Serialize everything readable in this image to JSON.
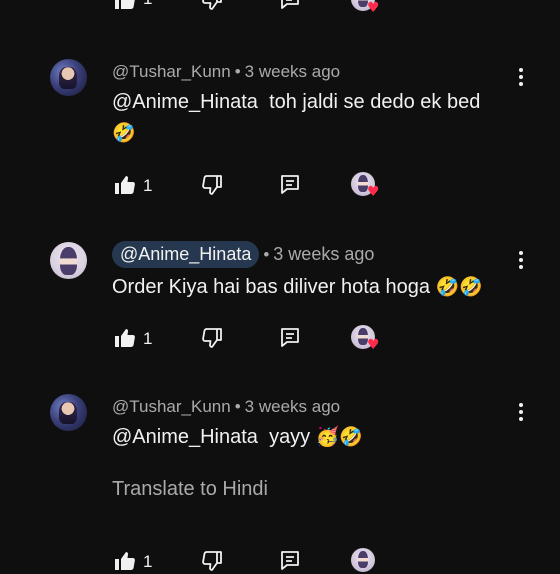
{
  "comments": [
    {
      "author": "@Tushar_Kunn",
      "time": "3 weeks ago",
      "mention": "@Anime_Hinata",
      "text": "toh jaldi se dedo ek bed",
      "emoji": "🤣",
      "likes": "1"
    },
    {
      "author": "@Anime_Hinata",
      "time": "3 weeks ago",
      "text": "Order Kiya hai bas diliver hota hoga",
      "emoji": "🤣🤣",
      "likes": "1"
    },
    {
      "author": "@Tushar_Kunn",
      "time": "3 weeks ago",
      "mention": "@Anime_Hinata",
      "text": "yayy",
      "emoji": "🥳🤣",
      "translate": "Translate to Hindi"
    }
  ],
  "top_partial": {
    "likes": "1"
  },
  "bottom_partial": {
    "likes": "1"
  },
  "icons": {
    "like": "thumbs-up-icon",
    "dislike": "thumbs-down-icon",
    "reply": "reply-icon",
    "more": "more-vert-icon",
    "heart": "creator-heart-icon"
  },
  "colors": {
    "background": "#0f0f0f",
    "heart": "#ff2b4a",
    "chip": "#263850",
    "secondary": "#aaaaaa"
  }
}
